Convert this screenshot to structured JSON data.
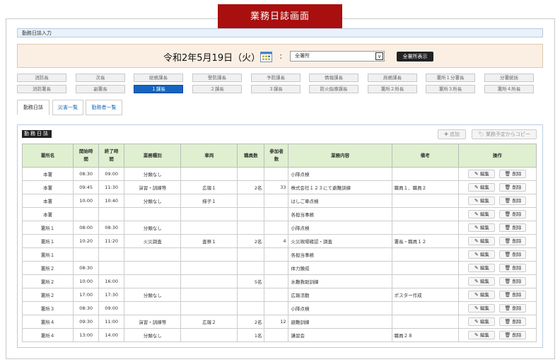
{
  "banner": "業務日誌画面",
  "breadcrumb": "勤務日誌入力",
  "date": "令和2年5月19日（火）",
  "colon": "：",
  "station_select": "全署所",
  "select_arrow": "∨",
  "show_all": "全署所表示",
  "roles": [
    "消防長",
    "次長",
    "総務課長",
    "警防課長",
    "予防課長",
    "情報課長",
    "庶務課長",
    "署所１分署長",
    "分署統括",
    "消防署長",
    "副署長",
    "１課長",
    "２課長",
    "３課長",
    "防火指導課長",
    "署所２所長",
    "署所３所長",
    "署所４所長"
  ],
  "active_role_index": 11,
  "tabs": [
    "勤務日誌",
    "災害一覧",
    "勤務者一覧"
  ],
  "panel_title": "勤務日誌",
  "add_button": "追加",
  "copy_button": "業務予定からコピー",
  "headers": [
    "署所名",
    "開始時間",
    "終了時間",
    "業務種別",
    "車両",
    "職員数",
    "参加者数",
    "業務内容",
    "備考",
    "操作"
  ],
  "edit_label": "編集",
  "delete_label": "削除",
  "rows": [
    [
      "本署",
      "08:30",
      "09:00",
      "分類なし",
      "",
      "",
      "",
      "小隊点検",
      ""
    ],
    [
      "本署",
      "09:45",
      "11:30",
      "演習・訓練等",
      "広報１",
      "2名",
      "33",
      "株式会社１２３にて避難訓練",
      "職員１、職員２"
    ],
    [
      "本署",
      "10:00",
      "10:40",
      "分類なし",
      "梯子１",
      "",
      "",
      "はしご車点検",
      ""
    ],
    [
      "本署",
      "",
      "",
      "",
      "",
      "",
      "",
      "各担当事務",
      ""
    ],
    [
      "署所１",
      "08:00",
      "08:30",
      "分類なし",
      "",
      "",
      "",
      "小隊点検",
      ""
    ],
    [
      "署所１",
      "10:20",
      "11:20",
      "火災調査",
      "査察１",
      "2名",
      "4",
      "火災現場確認・調査",
      "署長・職員１２"
    ],
    [
      "署所１",
      "",
      "",
      "",
      "",
      "",
      "",
      "各担当事務",
      ""
    ],
    [
      "署所２",
      "08:30",
      "",
      "",
      "",
      "",
      "",
      "体力錬成",
      ""
    ],
    [
      "署所２",
      "10:00",
      "16:00",
      "",
      "",
      "5名",
      "",
      "水難救助訓練",
      ""
    ],
    [
      "署所２",
      "17:00",
      "17:30",
      "分類なし",
      "",
      "",
      "",
      "広報活動",
      "ポスター作成"
    ],
    [
      "署所３",
      "08:30",
      "09:00",
      "",
      "",
      "",
      "",
      "小隊点検",
      ""
    ],
    [
      "署所４",
      "09:30",
      "11:00",
      "演習・訓練等",
      "広報２",
      "2名",
      "12",
      "避難訓練",
      ""
    ],
    [
      "署所４",
      "13:00",
      "14:00",
      "分類なし",
      "",
      "1名",
      "",
      "講習会",
      "職員２８"
    ]
  ],
  "colors": {
    "banner": "#a90f0f",
    "active_role": "#1565c0",
    "header_bg": "#dff0d0"
  },
  "icons": {
    "calendar": "calendar-icon",
    "edit": "edit-icon",
    "delete": "trash-icon",
    "add": "plus-icon",
    "copy": "tag-icon"
  }
}
